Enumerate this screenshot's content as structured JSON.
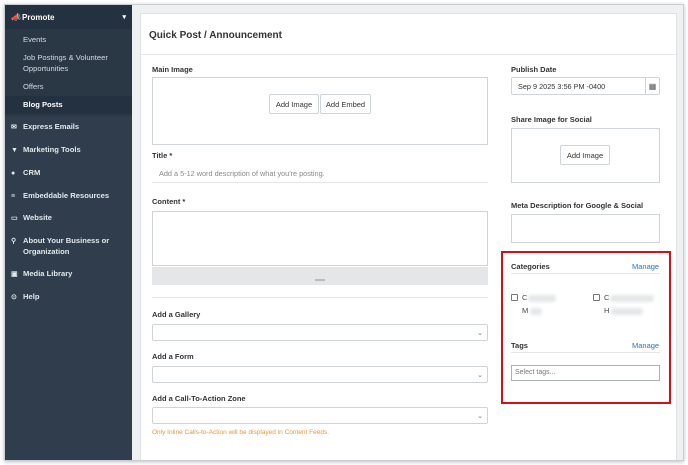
{
  "sidebar": {
    "section_title": "Promote",
    "sub_items": [
      "Events",
      "Job Postings & Volunteer Opportunities",
      "Offers",
      "Blog Posts"
    ],
    "active_sub_item": "Blog Posts",
    "items": [
      {
        "icon": "envelope-icon",
        "label": "Express Emails"
      },
      {
        "icon": "funnel-icon",
        "label": "Marketing Tools"
      },
      {
        "icon": "users-icon",
        "label": "CRM"
      },
      {
        "icon": "embed-icon",
        "label": "Embeddable Resources"
      },
      {
        "icon": "monitor-icon",
        "label": "Website"
      },
      {
        "icon": "map-pin-icon",
        "label": "About Your Business or Organization"
      },
      {
        "icon": "image-icon",
        "label": "Media Library"
      },
      {
        "icon": "lifebuoy-icon",
        "label": "Help"
      }
    ]
  },
  "form": {
    "title": "Quick Post / Announcement",
    "main_image_label": "Main Image",
    "add_image_label": "Add Image",
    "add_embed_label": "Add Embed",
    "title_label": "Title *",
    "title_placeholder": "Add a 5-12 word description of what you're posting.",
    "content_label": "Content *",
    "gallery_label": "Add a Gallery",
    "form_label": "Add a Form",
    "cta_label": "Add a Call-To-Action Zone",
    "cta_note": "Only Inline Calls-to-Action will be displayed in Content Feeds.",
    "publish_date_label": "Publish Date",
    "publish_date_value": "Sep 9 2025 3:56 PM -0400",
    "share_image_label": "Share Image for Social",
    "share_add_image_label": "Add Image",
    "meta_label": "Meta Description for Google & Social",
    "categories_label": "Categories",
    "categories_manage": "Manage",
    "category_1_initial": "C",
    "category_1_line2": "M",
    "category_2_initial": "C",
    "category_2_line2": "H",
    "tags_label": "Tags",
    "tags_manage": "Manage",
    "tags_placeholder": "Select tags..."
  },
  "colors": {
    "sidebar_bg": "#2f3d4c",
    "highlight": "#d0101a",
    "link": "#2a73b8",
    "note": "#e8963a"
  }
}
